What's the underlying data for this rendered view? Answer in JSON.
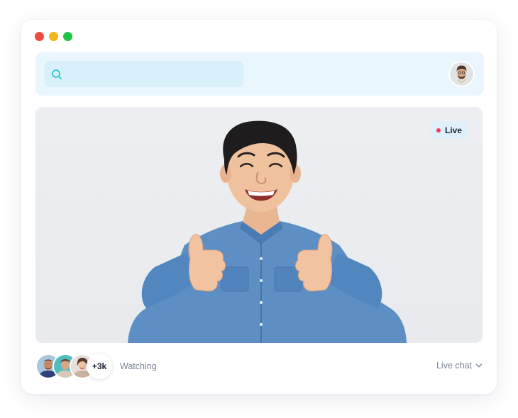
{
  "window": {
    "controls": [
      "close",
      "minimize",
      "maximize"
    ]
  },
  "topbar": {
    "search": {
      "icon": "search-icon",
      "placeholder": "",
      "value": ""
    },
    "user_avatar": "user-avatar"
  },
  "video": {
    "live_badge": {
      "label": "Live",
      "dot_color": "#f33b57"
    }
  },
  "footer": {
    "viewer_avatars": [
      "viewer-avatar-1",
      "viewer-avatar-2",
      "viewer-avatar-3"
    ],
    "viewer_count": "+3k",
    "watching_label": "Watching",
    "live_chat_label": "Live chat",
    "live_chat_icon": "chevron-down-icon"
  },
  "colors": {
    "accent": "#1ec6c6",
    "topbar_bg": "#e9f6fd",
    "search_bg": "#d8f0fb",
    "live_dot": "#f33b57",
    "traffic_red": "#f24a43",
    "traffic_yellow": "#f7b313",
    "traffic_green": "#1ec443"
  }
}
